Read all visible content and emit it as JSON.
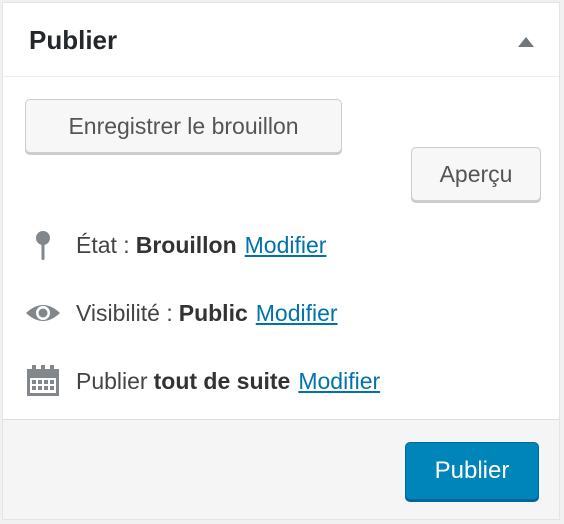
{
  "panel": {
    "title": "Publier",
    "toggle_icon": "triangle-up-icon"
  },
  "actions": {
    "save_draft_label": "Enregistrer le brouillon",
    "preview_label": "Aperçu"
  },
  "status": {
    "icon": "pin-icon",
    "label": "État :",
    "value": "Brouillon",
    "edit_label": "Modifier"
  },
  "visibility": {
    "icon": "eye-icon",
    "label": "Visibilité :",
    "value": "Public",
    "edit_label": "Modifier"
  },
  "schedule": {
    "icon": "calendar-icon",
    "label": "Publier",
    "value": "tout de suite",
    "edit_label": "Modifier"
  },
  "footer": {
    "publish_label": "Publier"
  },
  "colors": {
    "link": "#0073aa",
    "primary_button": "#0085ba",
    "icon": "#82878c"
  }
}
